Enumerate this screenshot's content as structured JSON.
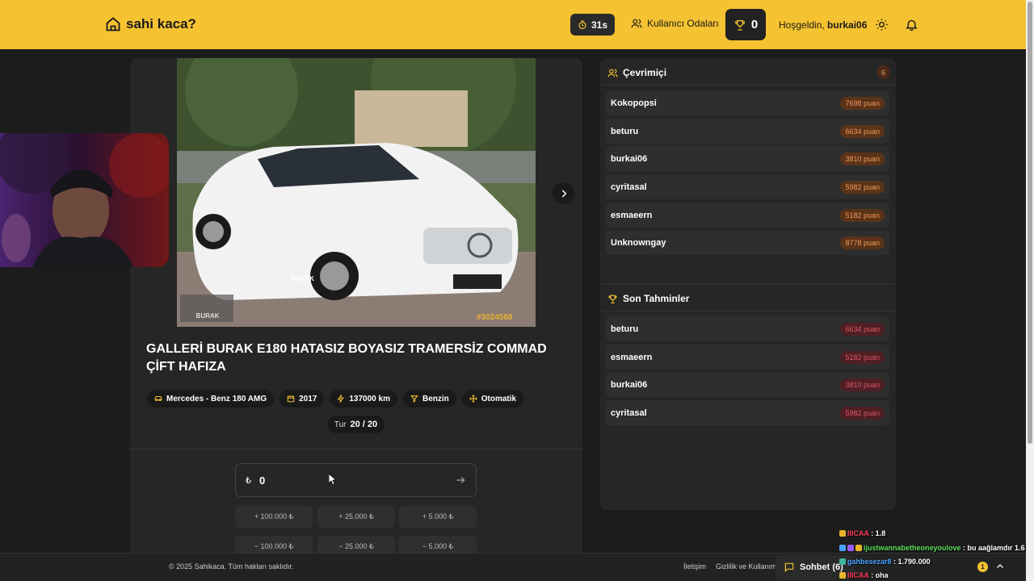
{
  "header": {
    "logo_text": "sahi kaca?",
    "timer": "31s",
    "rooms_label": "Kullanıcı Odaları",
    "score": "0",
    "welcome_prefix": "Hoşgeldin,",
    "username": "burkai06"
  },
  "listing": {
    "image_watermark": "#3024568",
    "image_brand": "BURAK",
    "title": "GALLERİ BURAK E180 HATASIZ BOYASIZ TRAMERSİZ COMMAD ÇİFT HAFIZA",
    "tags": [
      {
        "icon": "car-icon",
        "label": "Mercedes - Benz 180 AMG"
      },
      {
        "icon": "calendar-icon",
        "label": "2017"
      },
      {
        "icon": "gauge-icon",
        "label": "137000 km"
      },
      {
        "icon": "fuel-icon",
        "label": "Benzin"
      },
      {
        "icon": "gear-icon",
        "label": "Otomatik"
      }
    ],
    "round_label": "Tur",
    "round_value": "20 / 20"
  },
  "guess": {
    "currency": "₺",
    "value": "0",
    "buttons_add": [
      "+ 100.000 ₺",
      "+ 25.000 ₺",
      "+ 5.000 ₺"
    ],
    "buttons_sub": [
      "− 100.000 ₺",
      "− 25.000 ₺",
      "− 5.000 ₺"
    ]
  },
  "online": {
    "title": "Çevrimiçi",
    "count": "6",
    "users": [
      {
        "name": "Kokopopsi",
        "points": "7698 puan"
      },
      {
        "name": "beturu",
        "points": "6634 puan"
      },
      {
        "name": "burkai06",
        "points": "3810 puan"
      },
      {
        "name": "cyritasal",
        "points": "5982 puan"
      },
      {
        "name": "esmaeern",
        "points": "5182 puan"
      },
      {
        "name": "Unknowngay",
        "points": "8778 puan"
      }
    ]
  },
  "recent": {
    "title": "Son Tahminler",
    "items": [
      {
        "name": "beturu",
        "points": "6634 puan"
      },
      {
        "name": "esmaeern",
        "points": "5182 puan"
      },
      {
        "name": "burkai06",
        "points": "3810 puan"
      },
      {
        "name": "cyritasal",
        "points": "5982 puan"
      }
    ]
  },
  "footer": {
    "copyright": "© 2025 Sahikaca. Tüm hakları saklıdır.",
    "link_contact": "İletişim",
    "link_privacy": "Gizlilik ve Kullanım",
    "chat_label": "Sohbet (6)",
    "chat_badge": "1"
  },
  "stream_chat": [
    {
      "user": "IIICAA",
      "msg": ": 1.8"
    },
    {
      "user": "ijustwannabetheoneyoulove",
      "msg": ": bu aağlamdır 1.6"
    },
    {
      "user": "gahbesezar8",
      "msg": ": 1.790.000"
    },
    {
      "user": "IIICAA",
      "msg": ": oha"
    }
  ]
}
